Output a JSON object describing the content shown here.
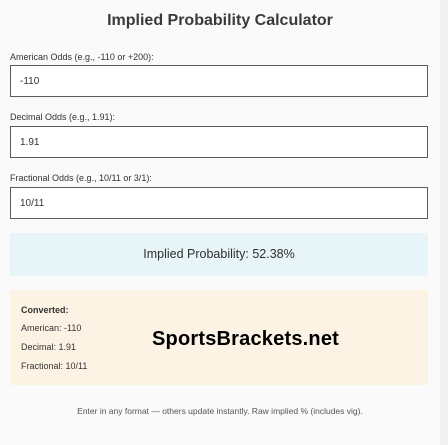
{
  "title": "Implied Probability Calculator",
  "american": {
    "label": "American Odds (e.g., -110 or +200):",
    "value": "-110"
  },
  "decimal": {
    "label": "Decimal Odds (e.g., 1.91):",
    "value": "1.91"
  },
  "fractional": {
    "label": "Fractional Odds (e.g., 10/11 or 3/1):",
    "value": "10/11"
  },
  "result": {
    "text": "Implied Probability: 52.38%"
  },
  "converted": {
    "heading": "Converted:",
    "american": "American: -110",
    "decimal": "Decimal: 1.91",
    "fractional": "Fractional: 10/11"
  },
  "brand": "SportsBrackets.net",
  "footer": "Enter in any format — others update instantly. Raw implied % (includes vig).",
  "colors": {
    "result_bg": "#e8f5f8",
    "converted_bg": "#fdf3e5",
    "field_border": "#5a5a5a"
  }
}
